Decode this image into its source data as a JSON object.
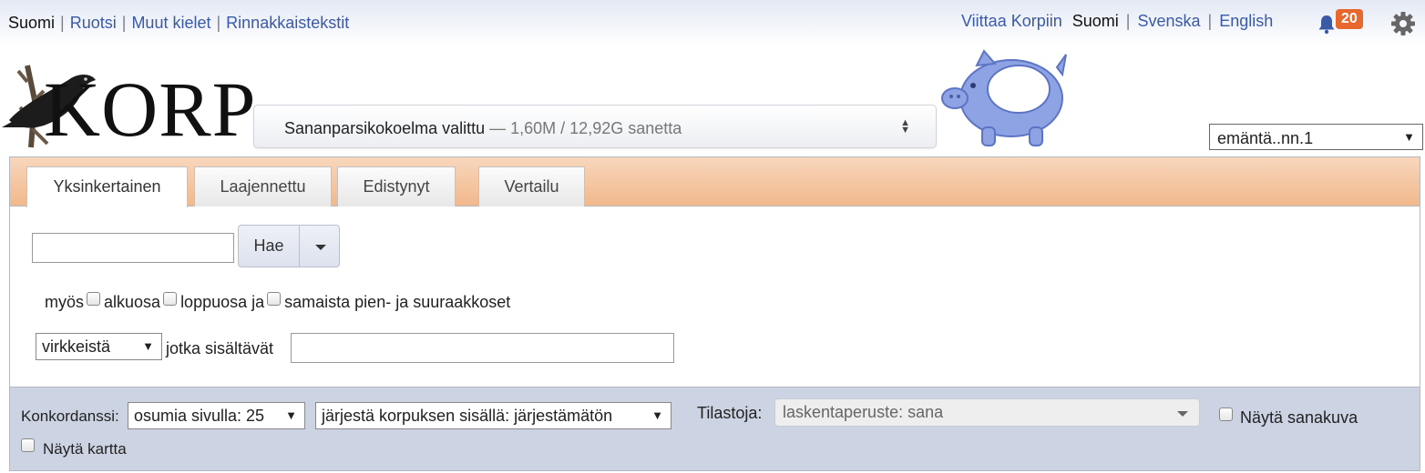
{
  "top_nav": {
    "links": [
      "Suomi",
      "Ruotsi",
      "Muut kielet",
      "Rinnakkaistekstit"
    ]
  },
  "top_right": {
    "cite": "Viittaa Korpiin",
    "langs": [
      "Suomi",
      "Svenska",
      "English"
    ],
    "notifications": "20"
  },
  "logo": {
    "text": "KORP"
  },
  "corpus": {
    "selected": "Sananparsikokoelma valittu",
    "size": "— 1,60M / 12,92G sanetta"
  },
  "search_history": {
    "value": "emäntä..nn.1"
  },
  "tabs": [
    "Yksinkertainen",
    "Laajennettu",
    "Edistynyt",
    "Vertailu"
  ],
  "simple": {
    "search_button": "Hae",
    "opt_also": "myös",
    "opt_prefix": "alkuosa",
    "opt_suffix": "loppuosa ja",
    "opt_case": "samaista pien- ja suuraakkoset",
    "context_unit": "virkkeistä",
    "context_label": "jotka sisältävät"
  },
  "bottom": {
    "kwic_label": "Konkordanssi:",
    "hits_per_page": "osumia sivulla: 25",
    "sort": "järjestä korpuksen sisällä: järjestämätön",
    "stats_label": "Tilastoja:",
    "stats_basis": "laskentaperuste: sana",
    "show_wordpicture": "Näytä sanakuva",
    "show_map": "Näytä kartta"
  },
  "colors": {
    "link": "#3a5aa8",
    "tab_strip": "#f1b88c",
    "bottom_bar": "#ccd4e3",
    "badge": "#e8672c"
  }
}
